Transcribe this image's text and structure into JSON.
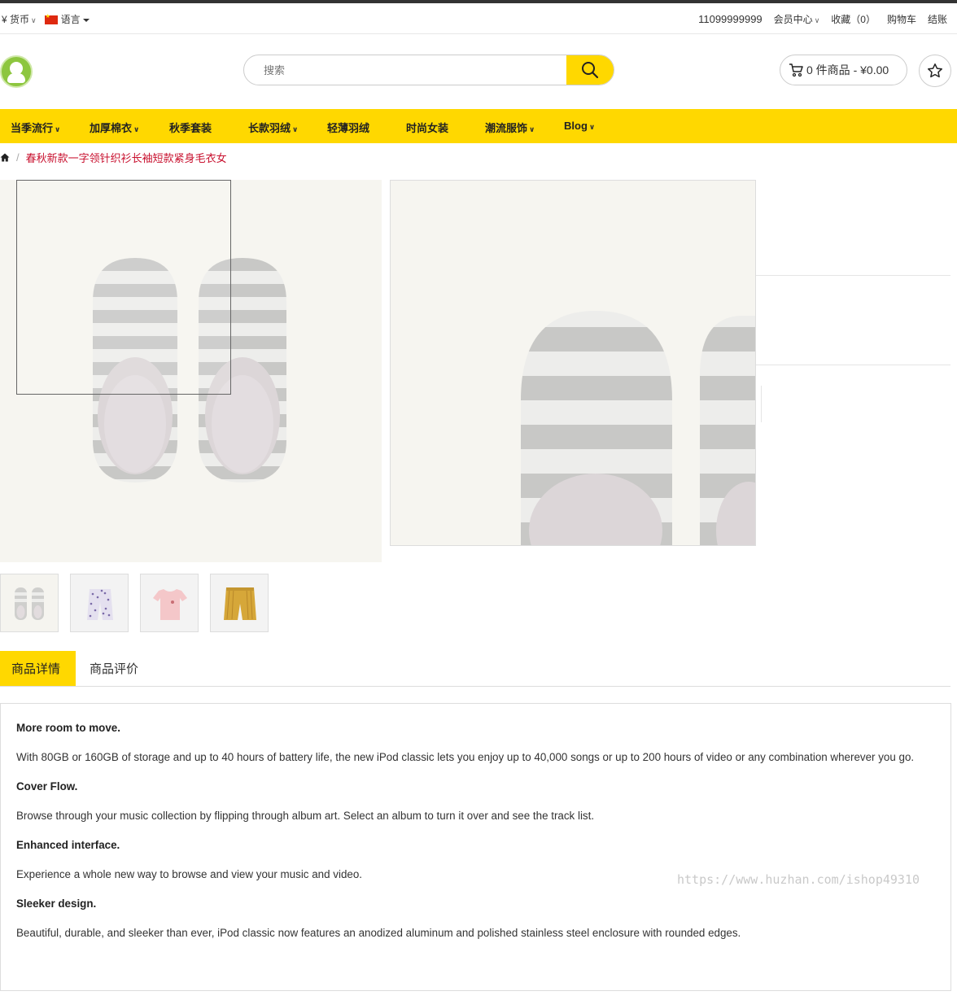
{
  "topbar": {
    "currency": "¥ 货币",
    "language": "语言",
    "phone": "11099999999",
    "member_center": "会员中心",
    "wishlist": "收藏（0）",
    "cart": "购物车",
    "checkout": "结账"
  },
  "header": {
    "search_placeholder": "搜索",
    "cart_summary": "0 件商品 - ¥0.00"
  },
  "nav": {
    "items": [
      {
        "label": "当季流行",
        "dropdown": true
      },
      {
        "label": "加厚棉衣",
        "dropdown": true
      },
      {
        "label": "秋季套装",
        "dropdown": false
      },
      {
        "label": "长款羽绒",
        "dropdown": true
      },
      {
        "label": "轻薄羽绒",
        "dropdown": false
      },
      {
        "label": "时尚女装",
        "dropdown": false
      },
      {
        "label": "潮流服饰",
        "dropdown": true
      },
      {
        "label": "Blog",
        "dropdown": true
      }
    ]
  },
  "breadcrumb": {
    "separator": "/",
    "current": "春秋新款一字领针织衫长袖短款紧身毛衣女"
  },
  "thumbnails": [
    {
      "name": "striped-slippers"
    },
    {
      "name": "floral-shorts"
    },
    {
      "name": "pink-tshirt"
    },
    {
      "name": "mustard-striped-shorts"
    }
  ],
  "tabs": {
    "details": "商品详情",
    "reviews": "商品评价"
  },
  "description": {
    "h1": "More room to move.",
    "p1": "With 80GB or 160GB of storage and up to 40 hours of battery life, the new iPod classic lets you enjoy up to 40,000 songs or up to 200 hours of video or any combination wherever you go.",
    "h2": "Cover Flow.",
    "p2": "Browse through your music collection by flipping through album art. Select an album to turn it over and see the track list.",
    "h3": "Enhanced interface.",
    "p3": "Experience a whole new way to browse and view your music and video.",
    "h4": "Sleeker design.",
    "p4": "Beautiful, durable, and sleeker than ever, iPod classic now features an anodized aluminum and polished stainless steel enclosure with rounded edges."
  },
  "watermark": "https://www.huzhan.com/ishop49310",
  "colors": {
    "accent": "#ffd800",
    "breadcrumb_current": "#c8102e",
    "logo": "#8dc63f"
  }
}
